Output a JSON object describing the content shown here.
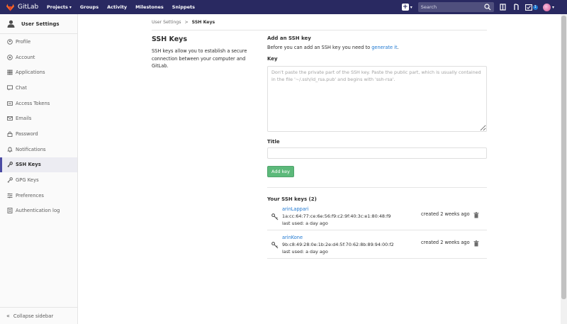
{
  "navbar": {
    "brand": "GitLab",
    "links": [
      {
        "label": "Projects",
        "has_caret": true
      },
      {
        "label": "Groups",
        "has_caret": false
      },
      {
        "label": "Activity",
        "has_caret": false
      },
      {
        "label": "Milestones",
        "has_caret": false
      },
      {
        "label": "Snippets",
        "has_caret": false
      }
    ],
    "search_placeholder": "Search",
    "todo_count": "1",
    "brand_color": "#292961"
  },
  "sidebar": {
    "title": "User Settings",
    "items": [
      {
        "label": "Profile",
        "icon": "profile-icon",
        "active": false
      },
      {
        "label": "Account",
        "icon": "account-icon",
        "active": false
      },
      {
        "label": "Applications",
        "icon": "applications-icon",
        "active": false
      },
      {
        "label": "Chat",
        "icon": "chat-icon",
        "active": false
      },
      {
        "label": "Access Tokens",
        "icon": "access-tokens-icon",
        "active": false
      },
      {
        "label": "Emails",
        "icon": "emails-icon",
        "active": false
      },
      {
        "label": "Password",
        "icon": "lock-icon",
        "active": false
      },
      {
        "label": "Notifications",
        "icon": "bell-icon",
        "active": false
      },
      {
        "label": "SSH Keys",
        "icon": "key-icon",
        "active": true
      },
      {
        "label": "GPG Keys",
        "icon": "key-icon",
        "active": false
      },
      {
        "label": "Preferences",
        "icon": "preferences-icon",
        "active": false
      },
      {
        "label": "Authentication log",
        "icon": "log-icon",
        "active": false
      }
    ],
    "collapse_label": "Collapse sidebar"
  },
  "breadcrumb": {
    "parent": "User Settings",
    "separator": ">",
    "current": "SSH Keys"
  },
  "intro": {
    "title": "SSH Keys",
    "description": "SSH keys allow you to establish a secure connection between your computer and GitLab."
  },
  "form": {
    "section_title": "Add an SSH key",
    "desc_prefix": "Before you can add an SSH key you need to ",
    "desc_link": "generate it",
    "desc_suffix": ".",
    "key_label": "Key",
    "key_placeholder": "Don't paste the private part of the SSH key. Paste the public part, which is usually contained in the file '~/.ssh/id_rsa.pub' and begins with 'ssh-rsa'.",
    "title_label": "Title",
    "title_value": "",
    "add_button": "Add key"
  },
  "keys": {
    "heading": "Your SSH keys (2)",
    "items": [
      {
        "name": "arinLappari",
        "fingerprint": "1a:cc:64:77:ce:6e:56:f9:c2:9f:40:3c:e1:80:48:f9",
        "last_used": "last used: a day ago",
        "created": "created 2 weeks ago"
      },
      {
        "name": "arinKone",
        "fingerprint": "9b:c8:49:28:0e:1b:2e:d4:5f:70:62:8b:89:94:00:f2",
        "last_used": "last used: a day ago",
        "created": "created 2 weeks ago"
      }
    ]
  }
}
